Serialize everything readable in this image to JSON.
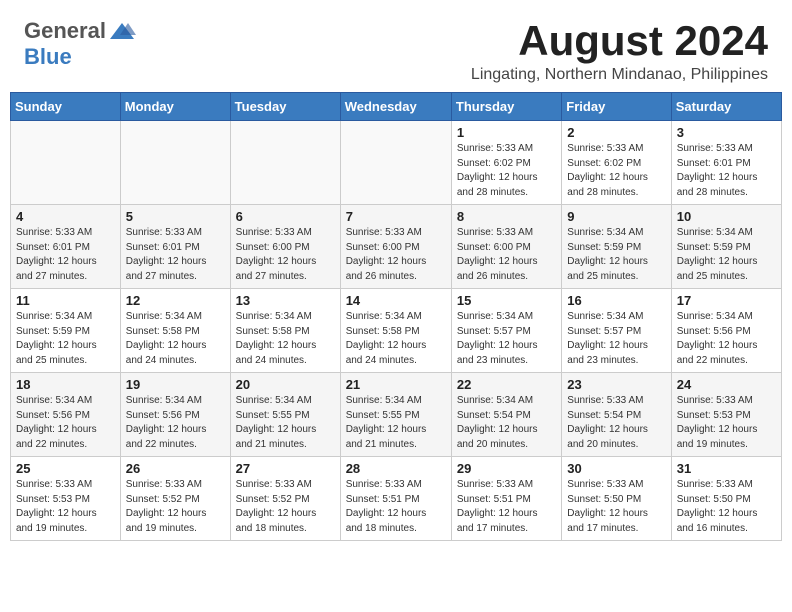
{
  "header": {
    "logo": {
      "general": "General",
      "blue": "Blue"
    },
    "month_year": "August 2024",
    "location": "Lingating, Northern Mindanao, Philippines"
  },
  "weekdays": [
    "Sunday",
    "Monday",
    "Tuesday",
    "Wednesday",
    "Thursday",
    "Friday",
    "Saturday"
  ],
  "weeks": [
    [
      {
        "day": "",
        "info": ""
      },
      {
        "day": "",
        "info": ""
      },
      {
        "day": "",
        "info": ""
      },
      {
        "day": "",
        "info": ""
      },
      {
        "day": "1",
        "info": "Sunrise: 5:33 AM\nSunset: 6:02 PM\nDaylight: 12 hours\nand 28 minutes."
      },
      {
        "day": "2",
        "info": "Sunrise: 5:33 AM\nSunset: 6:02 PM\nDaylight: 12 hours\nand 28 minutes."
      },
      {
        "day": "3",
        "info": "Sunrise: 5:33 AM\nSunset: 6:01 PM\nDaylight: 12 hours\nand 28 minutes."
      }
    ],
    [
      {
        "day": "4",
        "info": "Sunrise: 5:33 AM\nSunset: 6:01 PM\nDaylight: 12 hours\nand 27 minutes."
      },
      {
        "day": "5",
        "info": "Sunrise: 5:33 AM\nSunset: 6:01 PM\nDaylight: 12 hours\nand 27 minutes."
      },
      {
        "day": "6",
        "info": "Sunrise: 5:33 AM\nSunset: 6:00 PM\nDaylight: 12 hours\nand 27 minutes."
      },
      {
        "day": "7",
        "info": "Sunrise: 5:33 AM\nSunset: 6:00 PM\nDaylight: 12 hours\nand 26 minutes."
      },
      {
        "day": "8",
        "info": "Sunrise: 5:33 AM\nSunset: 6:00 PM\nDaylight: 12 hours\nand 26 minutes."
      },
      {
        "day": "9",
        "info": "Sunrise: 5:34 AM\nSunset: 5:59 PM\nDaylight: 12 hours\nand 25 minutes."
      },
      {
        "day": "10",
        "info": "Sunrise: 5:34 AM\nSunset: 5:59 PM\nDaylight: 12 hours\nand 25 minutes."
      }
    ],
    [
      {
        "day": "11",
        "info": "Sunrise: 5:34 AM\nSunset: 5:59 PM\nDaylight: 12 hours\nand 25 minutes."
      },
      {
        "day": "12",
        "info": "Sunrise: 5:34 AM\nSunset: 5:58 PM\nDaylight: 12 hours\nand 24 minutes."
      },
      {
        "day": "13",
        "info": "Sunrise: 5:34 AM\nSunset: 5:58 PM\nDaylight: 12 hours\nand 24 minutes."
      },
      {
        "day": "14",
        "info": "Sunrise: 5:34 AM\nSunset: 5:58 PM\nDaylight: 12 hours\nand 24 minutes."
      },
      {
        "day": "15",
        "info": "Sunrise: 5:34 AM\nSunset: 5:57 PM\nDaylight: 12 hours\nand 23 minutes."
      },
      {
        "day": "16",
        "info": "Sunrise: 5:34 AM\nSunset: 5:57 PM\nDaylight: 12 hours\nand 23 minutes."
      },
      {
        "day": "17",
        "info": "Sunrise: 5:34 AM\nSunset: 5:56 PM\nDaylight: 12 hours\nand 22 minutes."
      }
    ],
    [
      {
        "day": "18",
        "info": "Sunrise: 5:34 AM\nSunset: 5:56 PM\nDaylight: 12 hours\nand 22 minutes."
      },
      {
        "day": "19",
        "info": "Sunrise: 5:34 AM\nSunset: 5:56 PM\nDaylight: 12 hours\nand 22 minutes."
      },
      {
        "day": "20",
        "info": "Sunrise: 5:34 AM\nSunset: 5:55 PM\nDaylight: 12 hours\nand 21 minutes."
      },
      {
        "day": "21",
        "info": "Sunrise: 5:34 AM\nSunset: 5:55 PM\nDaylight: 12 hours\nand 21 minutes."
      },
      {
        "day": "22",
        "info": "Sunrise: 5:34 AM\nSunset: 5:54 PM\nDaylight: 12 hours\nand 20 minutes."
      },
      {
        "day": "23",
        "info": "Sunrise: 5:33 AM\nSunset: 5:54 PM\nDaylight: 12 hours\nand 20 minutes."
      },
      {
        "day": "24",
        "info": "Sunrise: 5:33 AM\nSunset: 5:53 PM\nDaylight: 12 hours\nand 19 minutes."
      }
    ],
    [
      {
        "day": "25",
        "info": "Sunrise: 5:33 AM\nSunset: 5:53 PM\nDaylight: 12 hours\nand 19 minutes."
      },
      {
        "day": "26",
        "info": "Sunrise: 5:33 AM\nSunset: 5:52 PM\nDaylight: 12 hours\nand 19 minutes."
      },
      {
        "day": "27",
        "info": "Sunrise: 5:33 AM\nSunset: 5:52 PM\nDaylight: 12 hours\nand 18 minutes."
      },
      {
        "day": "28",
        "info": "Sunrise: 5:33 AM\nSunset: 5:51 PM\nDaylight: 12 hours\nand 18 minutes."
      },
      {
        "day": "29",
        "info": "Sunrise: 5:33 AM\nSunset: 5:51 PM\nDaylight: 12 hours\nand 17 minutes."
      },
      {
        "day": "30",
        "info": "Sunrise: 5:33 AM\nSunset: 5:50 PM\nDaylight: 12 hours\nand 17 minutes."
      },
      {
        "day": "31",
        "info": "Sunrise: 5:33 AM\nSunset: 5:50 PM\nDaylight: 12 hours\nand 16 minutes."
      }
    ]
  ]
}
